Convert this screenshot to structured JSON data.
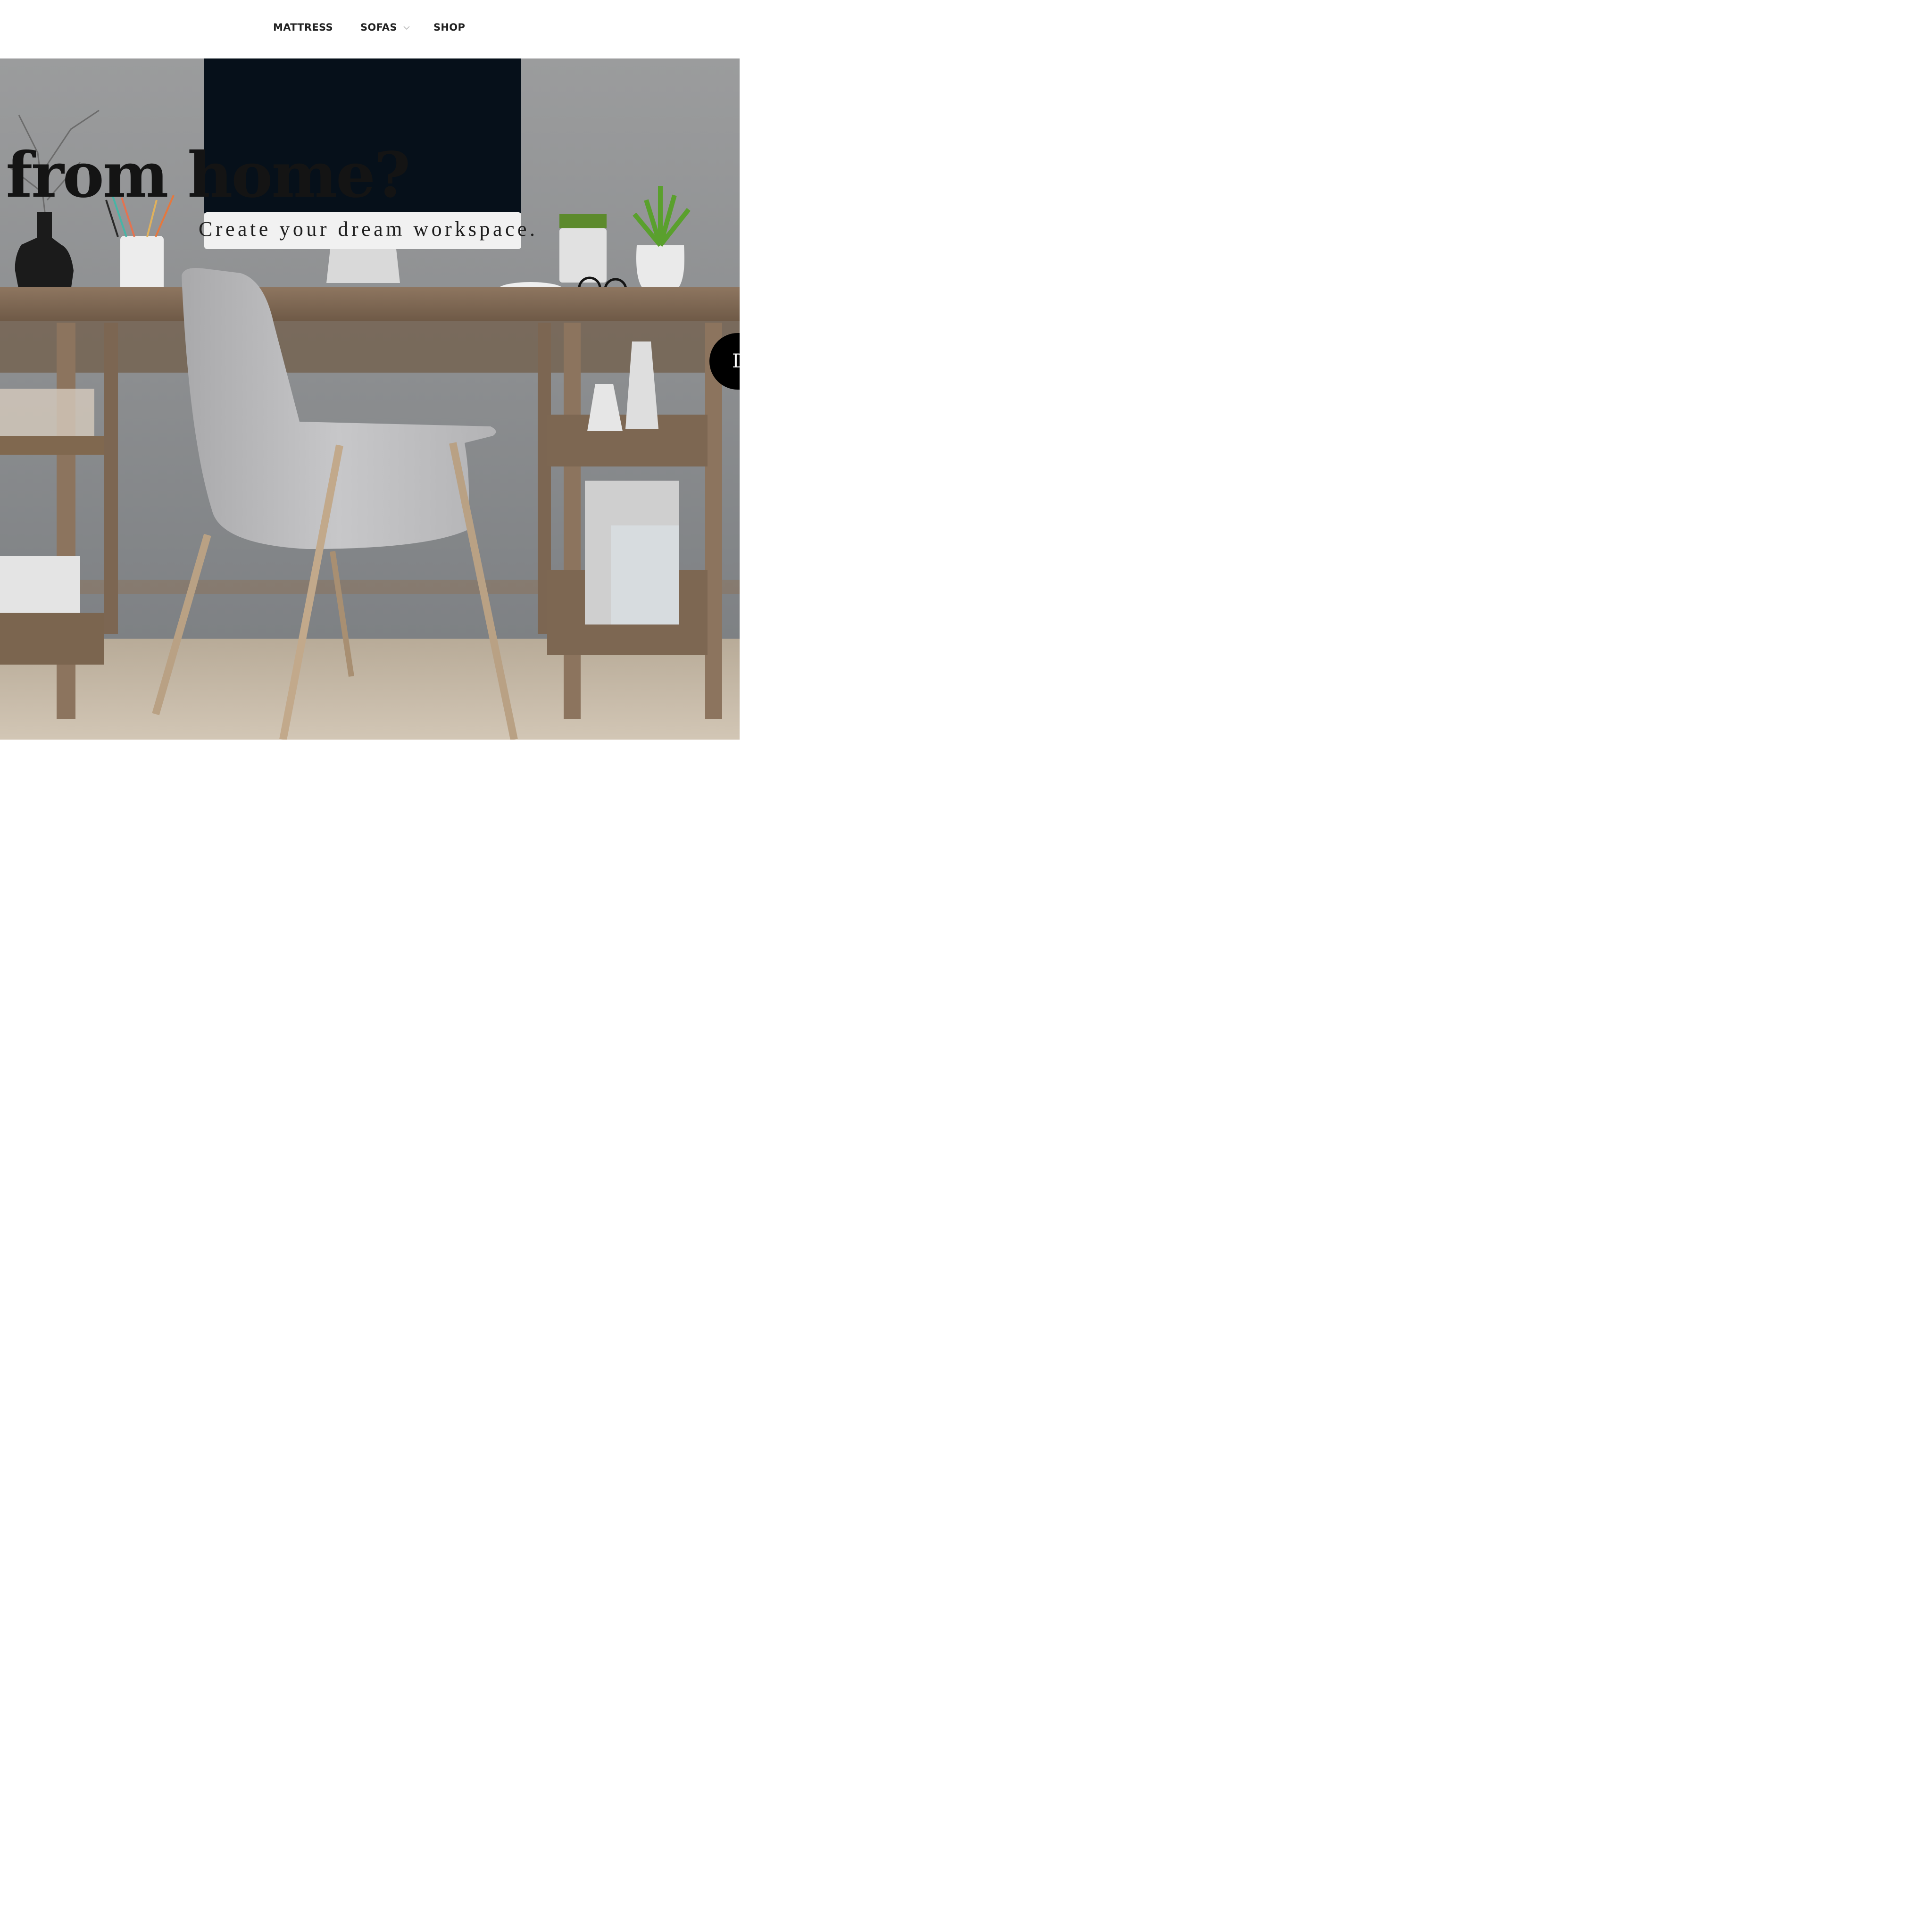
{
  "nav": {
    "items": [
      {
        "label": "MATTRESS",
        "has_dropdown": false
      },
      {
        "label": "SOFAS",
        "has_dropdown": true
      },
      {
        "label": "SHOP",
        "has_dropdown": false
      }
    ]
  },
  "hero": {
    "headline": "ing from home?",
    "subheadline": "Create your dream workspace.",
    "cta_label": "D"
  },
  "colors": {
    "nav_text": "#222222",
    "headline": "#141414",
    "cta_bg": "#000000",
    "cta_text": "#ffffff"
  },
  "icons": {
    "sofas_dropdown": "chevron-down-icon"
  }
}
